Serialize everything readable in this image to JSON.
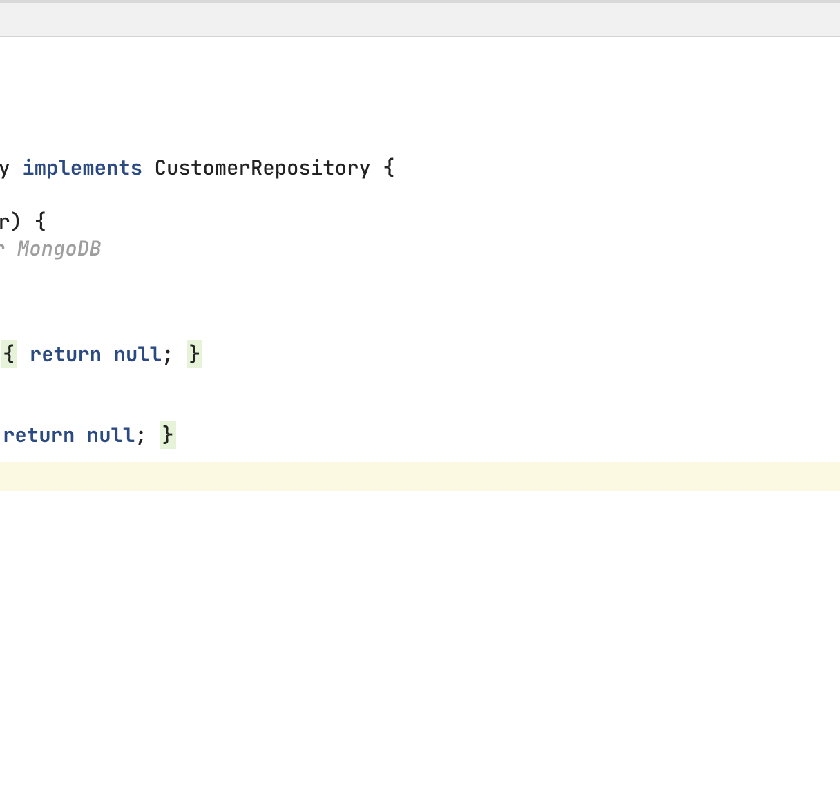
{
  "code": {
    "line1_ry": "ry ",
    "line1_implements": "implements",
    "line1_rest": " CustomerRepository {",
    "line2_er": "er) {",
    "line3_comment": "r MongoDB",
    "line4_pre_brace": "{",
    "line4_return": " return null",
    "line4_semi": "; ",
    "line4_close": "}",
    "line5_return": "return null",
    "line5_semi": "; ",
    "line5_close": "}"
  }
}
